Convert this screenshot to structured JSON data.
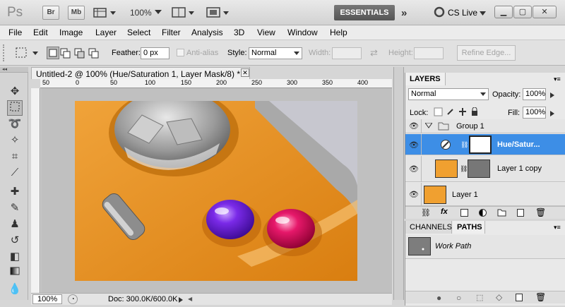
{
  "titlebar": {
    "logo": "Ps",
    "bridge": "Br",
    "minibridge": "Mb",
    "zoom": "100%",
    "workspace": "ESSENTIALS",
    "cslive": "CS Live"
  },
  "menu": [
    "File",
    "Edit",
    "Image",
    "Layer",
    "Select",
    "Filter",
    "Analysis",
    "3D",
    "View",
    "Window",
    "Help"
  ],
  "options": {
    "feather_label": "Feather:",
    "feather_value": "0 px",
    "antialias": "Anti-alias",
    "style_label": "Style:",
    "style_value": "Normal",
    "width_label": "Width:",
    "height_label": "Height:",
    "refine": "Refine Edge..."
  },
  "document": {
    "tab_title": "Untitled-2 @ 100% (Hue/Saturation 1, Layer Mask/8) *",
    "close": "✕",
    "ruler_ticks": [
      "50",
      "0",
      "50",
      "100",
      "150",
      "200",
      "250",
      "300",
      "350",
      "400"
    ]
  },
  "status": {
    "zoom": "100%",
    "doc": "Doc: 300.0K/600.0K"
  },
  "layers_panel": {
    "tab_layers": "LAYERS",
    "blend_mode": "Normal",
    "opacity_label": "Opacity:",
    "opacity_value": "100%",
    "lock_label": "Lock:",
    "fill_label": "Fill:",
    "fill_value": "100%",
    "layers": [
      {
        "name": "Group 1"
      },
      {
        "name": "Hue/Satur..."
      },
      {
        "name": "Layer 1 copy"
      },
      {
        "name": "Layer 1"
      }
    ]
  },
  "channels_panel": {
    "tab_channels": "CHANNELS",
    "tab_paths": "PATHS",
    "path_name": "Work Path"
  },
  "colors": {
    "selected_layer": "#3d8ee6",
    "orange": "#e8901c",
    "purple_button": "#6a1ad8",
    "pink_button": "#e0135c"
  }
}
